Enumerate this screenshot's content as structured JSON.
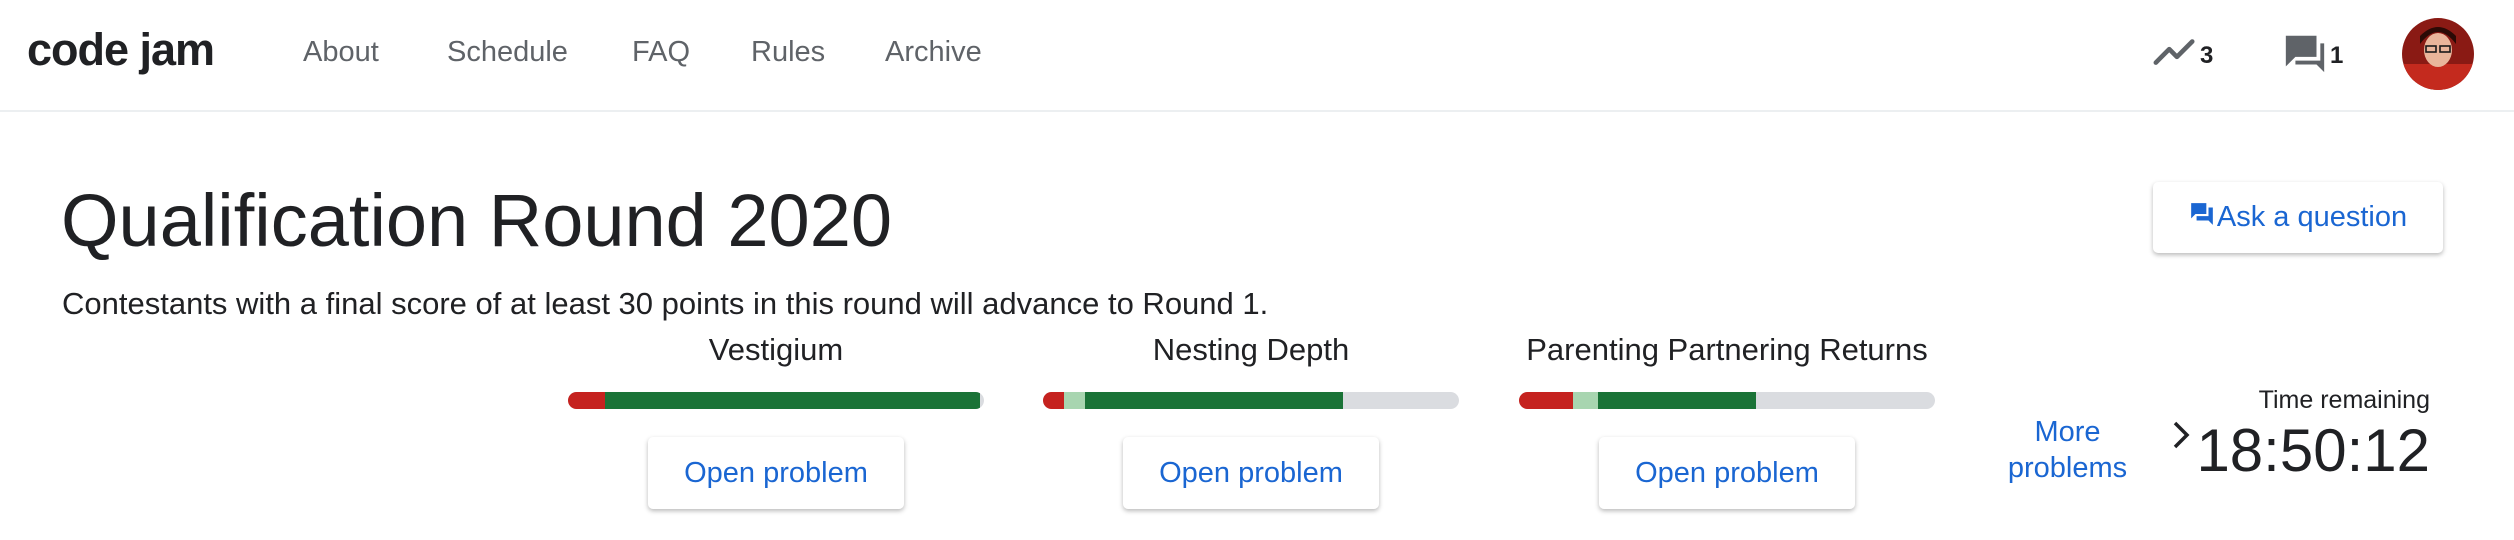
{
  "header": {
    "logo": "code jam",
    "nav": [
      "About",
      "Schedule",
      "FAQ",
      "Rules",
      "Archive"
    ],
    "scoreboard_count": "3",
    "clarifications_count": "1"
  },
  "round": {
    "title": "Qualification Round 2020",
    "subtitle": "Contestants with a final score of at least 30 points in this round will advance to Round 1.",
    "ask_label": "Ask a question"
  },
  "problems": [
    {
      "name": "Vestigium",
      "button": "Open problem",
      "progress": {
        "wrong": 0.09,
        "partial": 0.0,
        "solved": 0.9
      }
    },
    {
      "name": "Nesting Depth",
      "button": "Open problem",
      "progress": {
        "wrong": 0.05,
        "partial": 0.05,
        "solved": 0.62
      }
    },
    {
      "name": "Parenting Partnering Returns",
      "button": "Open problem",
      "progress": {
        "wrong": 0.13,
        "partial": 0.06,
        "solved": 0.38
      }
    }
  ],
  "more_problems": "More problems",
  "timer": {
    "label": "Time remaining",
    "value": "18:50:12"
  },
  "colors": {
    "wrong": "#c5221f",
    "partial": "#a8d5b0",
    "solved": "#1a7337",
    "track": "#dadce0",
    "link": "#1a66d2"
  }
}
